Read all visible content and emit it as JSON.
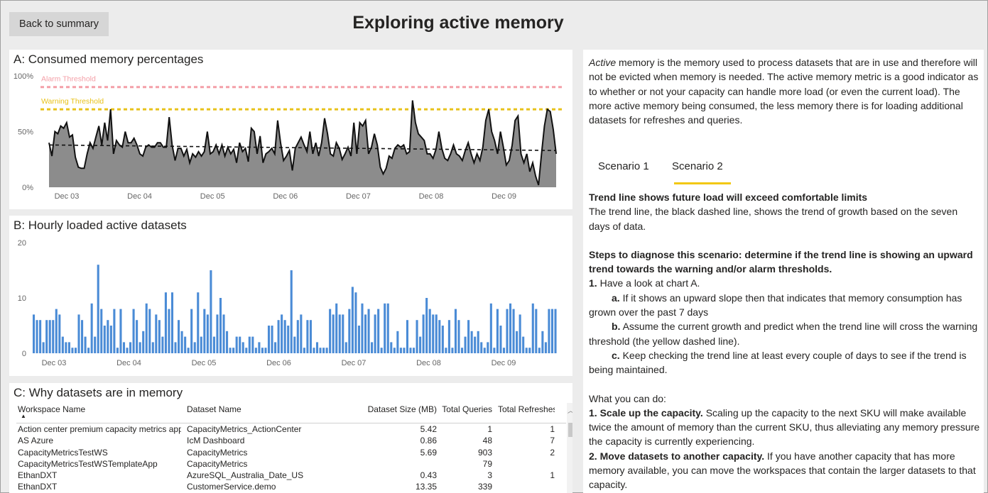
{
  "header": {
    "back_button": "Back to summary",
    "title": "Exploring active memory"
  },
  "colors": {
    "alarm": "#f4a0a8",
    "warning": "#e8c21a",
    "area_fill": "#8c8c8c",
    "bar": "#4a8bd6",
    "tab_accent": "#f2c811"
  },
  "chart_a": {
    "title": "A: Consumed memory percentages",
    "alarm_label": "Alarm Threshold",
    "warning_label": "Warning Threshold"
  },
  "chart_b": {
    "title": "B: Hourly loaded active datasets"
  },
  "table": {
    "title": "C: Why datasets are in memory",
    "columns": [
      "Workspace Name",
      "Dataset Name",
      "Dataset Size (MB)",
      "Total Queries",
      "Total Refreshes"
    ],
    "rows": [
      [
        "Action center premium capacity metrics app",
        "CapacityMetrics_ActionCenter",
        "5.42",
        "1",
        "1"
      ],
      [
        "AS Azure",
        "IcM Dashboard",
        "0.86",
        "48",
        "7"
      ],
      [
        "CapacityMetricsTestWS",
        "CapacityMetrics",
        "5.69",
        "903",
        "2"
      ],
      [
        "CapacityMetricsTestWSTemplateApp",
        "CapacityMetrics",
        "",
        "79",
        ""
      ],
      [
        "EthanDXT",
        "AzureSQL_Australia_Date_US",
        "0.43",
        "3",
        "1"
      ],
      [
        "EthanDXT",
        "CustomerService.demo",
        "13.35",
        "339",
        ""
      ]
    ]
  },
  "info": {
    "intro_em": "Active",
    "intro_rest": " memory is the memory used to process datasets that are in use and therefore will not be evicted when memory is needed.  The active memory metric is a good indicator as to whether or not your capacity can handle more load (or even the current load).  The more active memory being consumed, the less memory there is for loading additional datasets for refreshes and queries.",
    "tabs": [
      "Scenario 1",
      "Scenario 2"
    ],
    "heading": "Trend line shows future load will exceed comfortable limits",
    "heading_body": "The trend line, the black dashed line, shows the trend of growth based on the seven days of data.",
    "steps_heading": "Steps to diagnose this scenario: determine if the trend line is showing an upward trend towards the warning and/or alarm thresholds.",
    "step1_num": "1.",
    "step1_text": "  Have a look at chart A.",
    "step_a_letter": "a.",
    "step_a_text": " If it shows an upward slope then that indicates that memory consumption has grown over the past 7 days",
    "step_b_letter": "b.",
    "step_b_text": " Assume the current growth and predict when the trend line will cross the warning threshold (the yellow dashed line).",
    "step_c_letter": "c.",
    "step_c_text": "  Keep checking the trend line at least every couple of days to see if the trend is being maintained.",
    "what_heading": "What you can do:",
    "do1_title": "1.  Scale up the capacity.",
    "do1_text": "  Scaling up the capacity to the next SKU will make available twice the amount of memory than the current SKU, thus alleviating any memory pressure the capacity is currently experiencing.",
    "do2_title": "2.  Move datasets to another capacity.",
    "do2_text": "  If you have another capacity that has more memory available, you can move the workspaces that contain the larger datasets to that capacity."
  },
  "chart_data": [
    {
      "type": "area",
      "title": "A: Consumed memory percentages",
      "y_ticks": [
        "0%",
        "50%",
        "100%"
      ],
      "ylim": [
        0,
        100
      ],
      "x_ticks": [
        "Dec 03",
        "Dec 04",
        "Dec 05",
        "Dec 06",
        "Dec 07",
        "Dec 08",
        "Dec 09"
      ],
      "thresholds": [
        {
          "name": "Alarm Threshold",
          "value": 90
        },
        {
          "name": "Warning Threshold",
          "value": 70
        }
      ],
      "trend": {
        "start": 38,
        "end": 33
      },
      "values": [
        40,
        28,
        50,
        48,
        55,
        53,
        58,
        45,
        47,
        27,
        18,
        17,
        17,
        30,
        40,
        35,
        45,
        55,
        38,
        58,
        42,
        70,
        30,
        42,
        38,
        36,
        50,
        40,
        40,
        44,
        38,
        30,
        28,
        36,
        38,
        36,
        36,
        40,
        40,
        36,
        36,
        63,
        38,
        24,
        35,
        35,
        28,
        34,
        22,
        30,
        27,
        32,
        28,
        32,
        50,
        30,
        32,
        38,
        30,
        38,
        28,
        36,
        30,
        34,
        22,
        40,
        32,
        35,
        23,
        53,
        50,
        30,
        46,
        22,
        30,
        32,
        35,
        30,
        60,
        40,
        24,
        28,
        33,
        15,
        35,
        40,
        45,
        38,
        32,
        50,
        30,
        40,
        28,
        40,
        62,
        48,
        30,
        28,
        40,
        35,
        25,
        30,
        36,
        28,
        58,
        30,
        58,
        55,
        60,
        30,
        36,
        48,
        38,
        18,
        12,
        17,
        28,
        26,
        35,
        38,
        36,
        38,
        30,
        32,
        78,
        58,
        48,
        45,
        42,
        30,
        30,
        26,
        34,
        50,
        35,
        26,
        24,
        30,
        38,
        30,
        28,
        24,
        33,
        40,
        30,
        22,
        30,
        24,
        36,
        60,
        70,
        50,
        42,
        30,
        50,
        36,
        20,
        24,
        38,
        60,
        64,
        30,
        22,
        30,
        14,
        22,
        10,
        2,
        30,
        55,
        70,
        68,
        52,
        30
      ]
    },
    {
      "type": "bar",
      "title": "B: Hourly loaded active datasets",
      "y_ticks": [
        "0",
        "10",
        "20"
      ],
      "ylim": [
        0,
        20
      ],
      "x_ticks": [
        "Dec 03",
        "Dec 04",
        "Dec 05",
        "Dec 06",
        "Dec 07",
        "Dec 08",
        "Dec 09"
      ],
      "values": [
        7,
        6,
        6,
        2,
        6,
        6,
        6,
        8,
        7,
        3,
        2,
        2,
        1,
        1,
        7,
        6,
        3,
        1,
        9,
        3,
        16,
        8,
        5,
        6,
        5,
        8,
        1,
        8,
        2,
        1,
        2,
        8,
        6,
        2,
        4,
        9,
        8,
        2,
        7,
        6,
        3,
        11,
        8,
        11,
        2,
        6,
        4,
        3,
        1,
        8,
        2,
        11,
        3,
        8,
        7,
        15,
        3,
        7,
        10,
        7,
        4,
        1,
        1,
        3,
        3,
        2,
        1,
        3,
        3,
        1,
        2,
        1,
        1,
        5,
        5,
        2,
        6,
        7,
        6,
        5,
        15,
        3,
        6,
        7,
        1,
        6,
        6,
        1,
        2,
        1,
        1,
        1,
        8,
        7,
        9,
        7,
        7,
        2,
        8,
        12,
        11,
        5,
        9,
        7,
        8,
        2,
        7,
        8,
        1,
        9,
        9,
        2,
        1,
        4,
        1,
        1,
        6,
        1,
        1,
        6,
        3,
        7,
        10,
        8,
        7,
        7,
        6,
        5,
        1,
        6,
        1,
        8,
        6,
        1,
        3,
        6,
        4,
        3,
        4,
        2,
        1,
        2,
        9,
        1,
        8,
        5,
        1,
        8,
        9,
        8,
        4,
        7,
        3,
        1,
        1,
        9,
        8,
        1,
        4,
        2,
        8,
        8,
        8
      ]
    }
  ]
}
